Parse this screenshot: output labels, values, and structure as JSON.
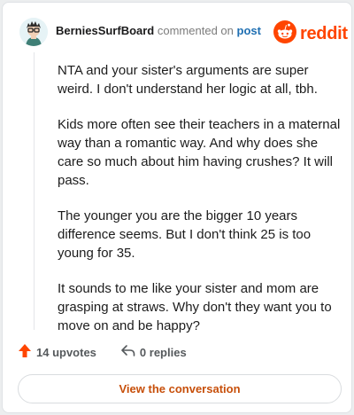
{
  "comment": {
    "username": "BerniesSurfBoard",
    "action": "commented on",
    "post_link": "post",
    "paragraphs": [
      "NTA and your sister's arguments are super weird. I don't understand her logic at all, tbh.",
      "Kids more often see their teachers in a maternal way than a romantic way. And why does she care so much about him having crushes? It will pass.",
      "The younger you are the bigger 10 years difference seems. But I don't think 25 is too young for 35.",
      "It sounds to me like your sister and mom are grasping at straws. Why don't they want you to move on and be happy?"
    ]
  },
  "brand": {
    "wordmark": "reddit",
    "color": "#ff4500"
  },
  "stats": {
    "upvotes": "14 upvotes",
    "replies": "0 replies"
  },
  "cta": {
    "label": "View the conversation"
  },
  "icons": {
    "upvote": "upvote-arrow-icon",
    "reply": "reply-arrow-icon",
    "logo": "reddit-snoo-icon"
  }
}
